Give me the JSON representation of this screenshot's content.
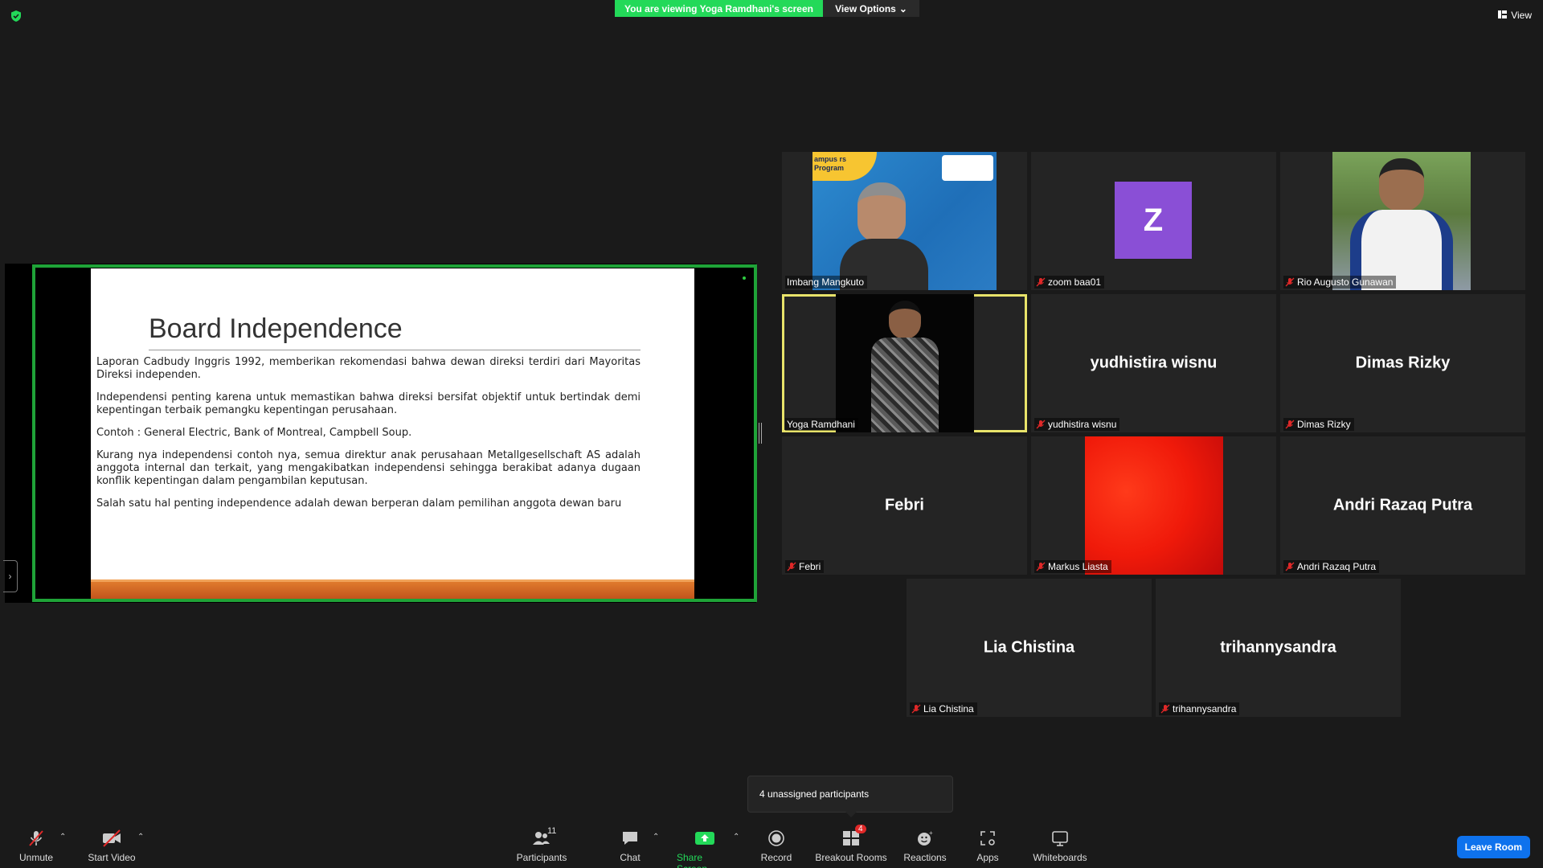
{
  "header": {
    "viewing_banner": "You are viewing Yoga Ramdhani's screen",
    "view_options": "View Options",
    "view_label": "View"
  },
  "slide": {
    "title": "Board Independence",
    "paragraphs": [
      "Laporan Cadbudy Inggris 1992, memberikan rekomendasi bahwa dewan direksi terdiri dari Mayoritas Direksi independen.",
      "Independensi penting karena untuk memastikan bahwa direksi bersifat objektif untuk bertindak demi kepentingan terbaik pemangku kepentingan perusahaan.",
      "Contoh : General Electric, Bank of Montreal, Campbell Soup.",
      "Kurang nya independensi contoh nya, semua direktur anak perusahaan Metallgesellschaft AS adalah anggota internal dan terkait, yang mengakibatkan independensi sehingga berakibat adanya dugaan konflik kepentingan dalam pengambilan keputusan.",
      "Salah satu hal penting independence adalah dewan berperan dalam pemilihan anggota dewan baru"
    ],
    "video_banner_text": "ampus rs Program"
  },
  "participants": [
    {
      "name": "Imbang Mangkuto",
      "muted": false,
      "display": "video"
    },
    {
      "name": "zoom baa01",
      "muted": true,
      "display": "avatar",
      "initial": "Z"
    },
    {
      "name": "Rio Augusto Gunawan",
      "muted": true,
      "display": "video"
    },
    {
      "name": "Yoga Ramdhani",
      "muted": false,
      "display": "video",
      "active": true
    },
    {
      "name": "yudhistira wisnu",
      "muted": true,
      "display": "name"
    },
    {
      "name": "Dimas Rizky",
      "muted": true,
      "display": "name"
    },
    {
      "name": "Febri",
      "muted": true,
      "display": "name"
    },
    {
      "name": "Markus Liasta",
      "muted": true,
      "display": "red-video"
    },
    {
      "name": "Andri Razaq Putra",
      "muted": true,
      "display": "name"
    },
    {
      "name": "Lia Chistina",
      "muted": true,
      "display": "name"
    },
    {
      "name": "trihannysandra",
      "muted": true,
      "display": "name"
    }
  ],
  "tooltip": "4 unassigned participants",
  "toolbar": {
    "unmute": "Unmute",
    "start_video": "Start Video",
    "participants": "Participants",
    "participants_count": "11",
    "chat": "Chat",
    "share_screen": "Share Screen",
    "record": "Record",
    "breakout_rooms": "Breakout Rooms",
    "breakout_badge": "4",
    "reactions": "Reactions",
    "apps": "Apps",
    "whiteboards": "Whiteboards",
    "leave_room": "Leave Room"
  },
  "colors": {
    "share_green": "#23d959",
    "frame_green": "#1fa338",
    "active_speaker": "#e8e36a",
    "avatar_purple": "#8a4fd6",
    "leave_blue": "#0e72ed",
    "muted_red": "#e02828"
  }
}
